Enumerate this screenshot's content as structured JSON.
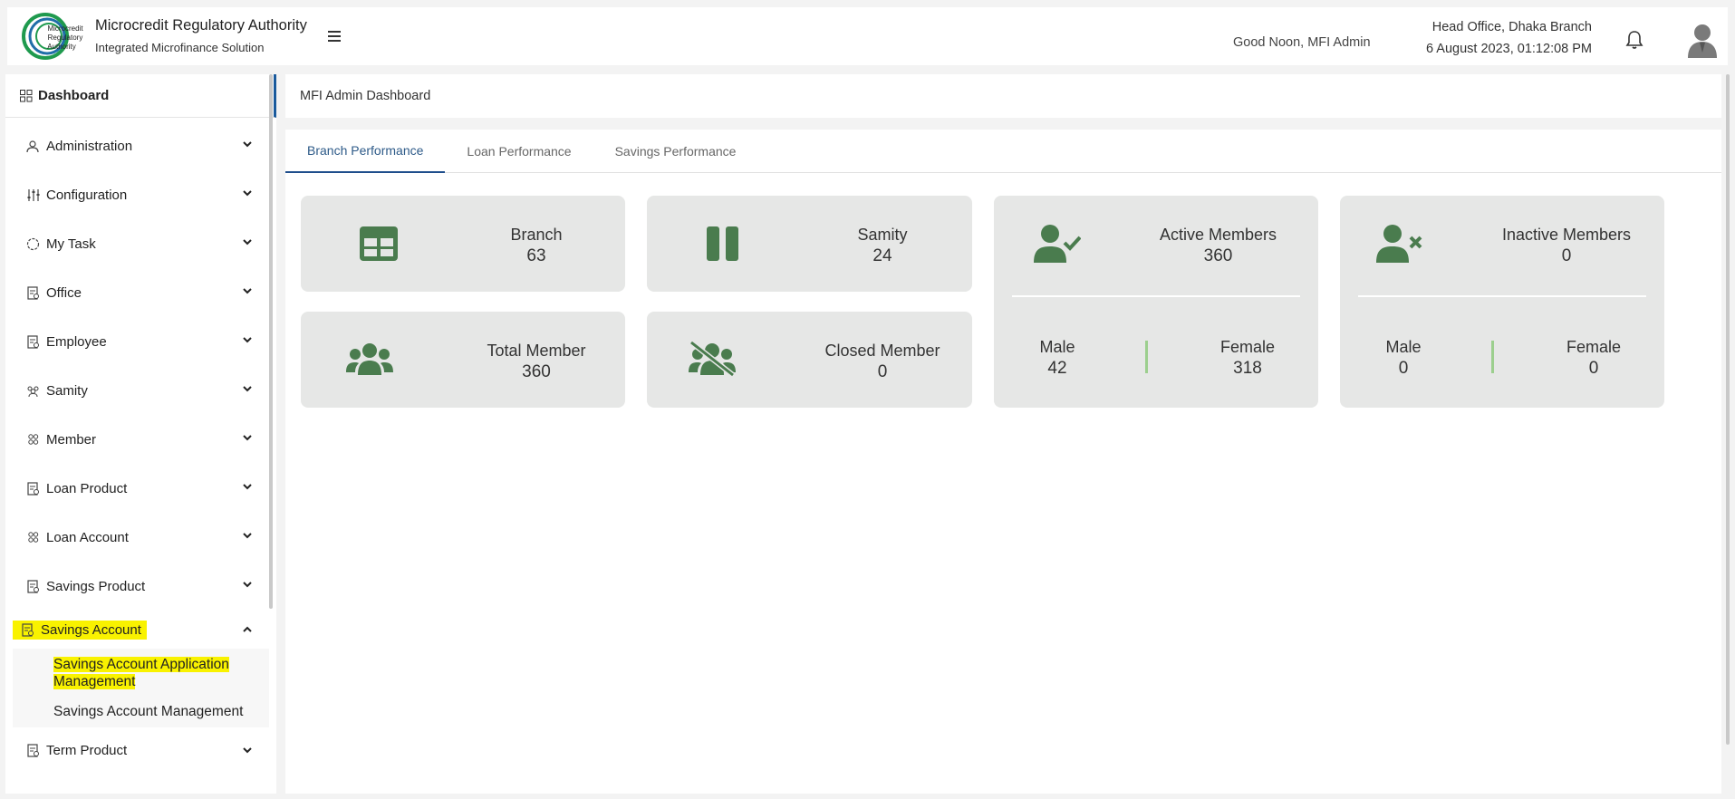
{
  "header": {
    "org_name": "Microcredit Regulatory Authority",
    "subtitle": "Integrated Microfinance Solution",
    "logo_text": "Microcredit Regulatory Authority",
    "greeting": "Good Noon, MFI Admin",
    "branch": "Head Office, Dhaka Branch",
    "datetime": "6 August 2023, 01:12:08 PM"
  },
  "sidebar": {
    "dashboard_label": "Dashboard",
    "items": [
      {
        "label": "Administration",
        "icon": "user-settings-icon"
      },
      {
        "label": "Configuration",
        "icon": "sliders-icon"
      },
      {
        "label": "My Task",
        "icon": "task-circle-icon"
      },
      {
        "label": "Office",
        "icon": "document-icon"
      },
      {
        "label": "Employee",
        "icon": "document-icon"
      },
      {
        "label": "Samity",
        "icon": "group-icon"
      },
      {
        "label": "Member",
        "icon": "members-icon"
      },
      {
        "label": "Loan Product",
        "icon": "document-icon"
      },
      {
        "label": "Loan Account",
        "icon": "members-icon"
      },
      {
        "label": "Savings Product",
        "icon": "document-icon"
      },
      {
        "label": "Savings Account",
        "icon": "document-icon"
      },
      {
        "label": "Term Product",
        "icon": "document-icon"
      }
    ],
    "submenu": [
      "Savings Account Application Management",
      "Savings Account Management"
    ],
    "highlight_color": "#f9f200"
  },
  "main": {
    "title": "MFI Admin Dashboard",
    "tabs": [
      "Branch Performance",
      "Loan Performance",
      "Savings Performance"
    ],
    "cards": {
      "branch": {
        "title": "Branch",
        "value": "63"
      },
      "samity": {
        "title": "Samity",
        "value": "24"
      },
      "total_member": {
        "title": "Total Member",
        "value": "360"
      },
      "closed_member": {
        "title": "Closed Member",
        "value": "0"
      },
      "active_members": {
        "title": "Active Members",
        "value": "360",
        "male_label": "Male",
        "male": "42",
        "female_label": "Female",
        "female": "318"
      },
      "inactive_members": {
        "title": "Inactive Members",
        "value": "0",
        "male_label": "Male",
        "male": "0",
        "female_label": "Female",
        "female": "0"
      }
    },
    "icon_color": "#4a7c4e"
  }
}
